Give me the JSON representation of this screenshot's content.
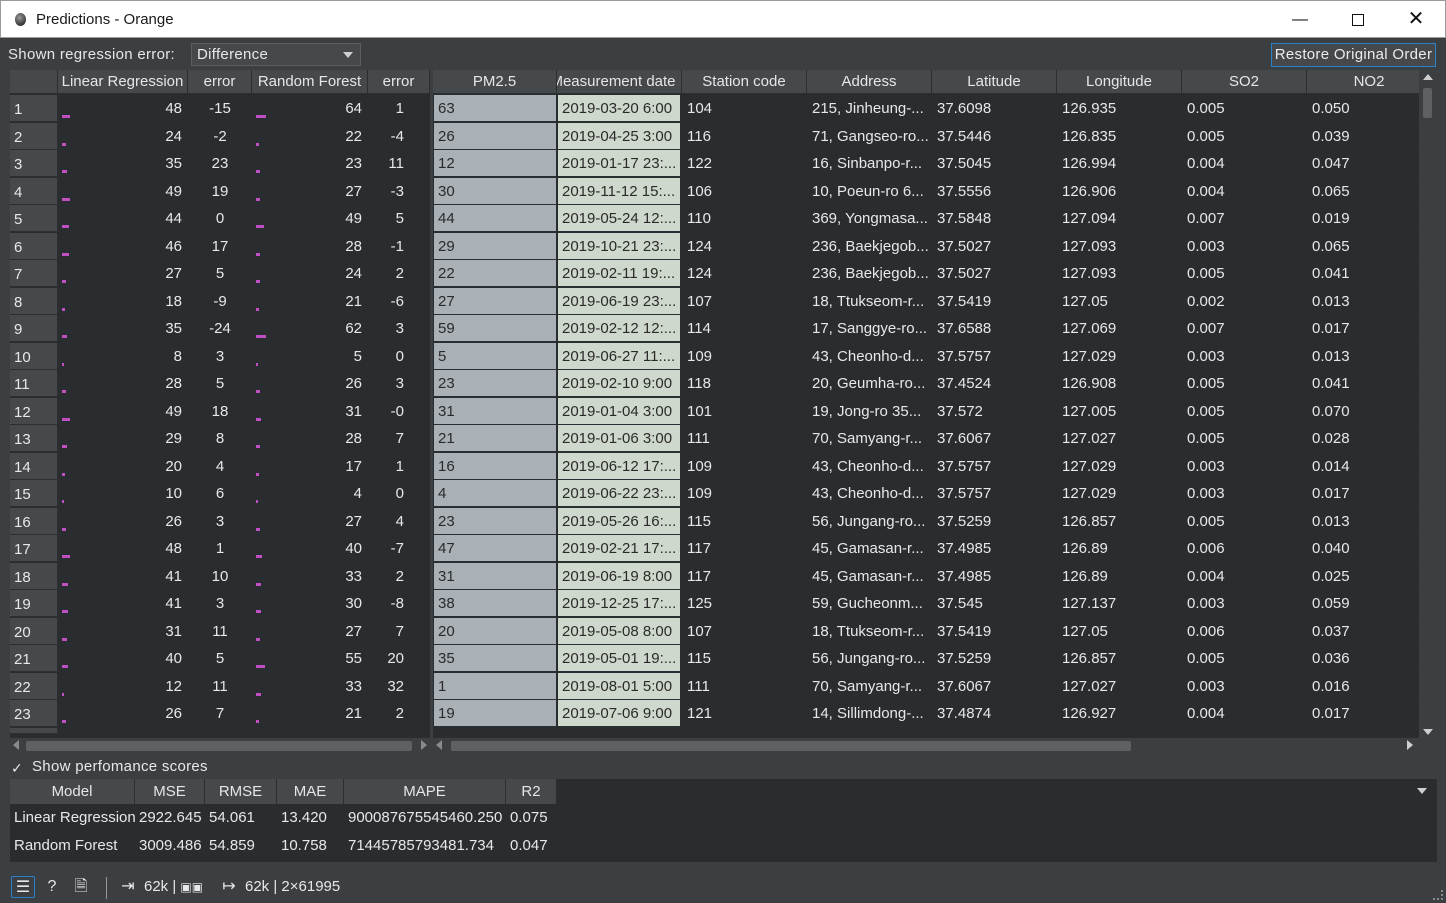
{
  "window": {
    "title": "Predictions - Orange"
  },
  "toolbar": {
    "error_label": "Shown regression error:",
    "error_mode": "Difference",
    "restore_button": "Restore Original Order"
  },
  "predictions": {
    "headers": [
      "Linear Regression",
      "error",
      "Random Forest",
      "error"
    ],
    "rows": [
      [
        "1",
        "48",
        "-15",
        "64",
        "1"
      ],
      [
        "2",
        "24",
        "-2",
        "22",
        "-4"
      ],
      [
        "3",
        "35",
        "23",
        "23",
        "11"
      ],
      [
        "4",
        "49",
        "19",
        "27",
        "-3"
      ],
      [
        "5",
        "44",
        "0",
        "49",
        "5"
      ],
      [
        "6",
        "46",
        "17",
        "28",
        "-1"
      ],
      [
        "7",
        "27",
        "5",
        "24",
        "2"
      ],
      [
        "8",
        "18",
        "-9",
        "21",
        "-6"
      ],
      [
        "9",
        "35",
        "-24",
        "62",
        "3"
      ],
      [
        "10",
        "8",
        "3",
        "5",
        "0"
      ],
      [
        "11",
        "28",
        "5",
        "26",
        "3"
      ],
      [
        "12",
        "49",
        "18",
        "31",
        "-0"
      ],
      [
        "13",
        "29",
        "8",
        "28",
        "7"
      ],
      [
        "14",
        "20",
        "4",
        "17",
        "1"
      ],
      [
        "15",
        "10",
        "6",
        "4",
        "0"
      ],
      [
        "16",
        "26",
        "3",
        "27",
        "4"
      ],
      [
        "17",
        "48",
        "1",
        "40",
        "-7"
      ],
      [
        "18",
        "41",
        "10",
        "33",
        "2"
      ],
      [
        "19",
        "41",
        "3",
        "30",
        "-8"
      ],
      [
        "20",
        "31",
        "11",
        "27",
        "7"
      ],
      [
        "21",
        "40",
        "5",
        "55",
        "20"
      ],
      [
        "22",
        "12",
        "11",
        "33",
        "32"
      ],
      [
        "23",
        "26",
        "7",
        "21",
        "2"
      ]
    ]
  },
  "data_table": {
    "headers": [
      "PM2.5",
      "Measurement date",
      "Station code",
      "Address",
      "Latitude",
      "Longitude",
      "SO2",
      "NO2"
    ],
    "rows": [
      [
        "63",
        "2019-03-20 6:00",
        "104",
        "215, Jinheung-...",
        "37.6098",
        "126.935",
        "0.005",
        "0.050"
      ],
      [
        "26",
        "2019-04-25 3:00",
        "116",
        "71, Gangseo-ro...",
        "37.5446",
        "126.835",
        "0.005",
        "0.039"
      ],
      [
        "12",
        "2019-01-17 23:...",
        "122",
        "16, Sinbanpo-r...",
        "37.5045",
        "126.994",
        "0.004",
        "0.047"
      ],
      [
        "30",
        "2019-11-12 15:...",
        "106",
        "10, Poeun-ro 6...",
        "37.5556",
        "126.906",
        "0.004",
        "0.065"
      ],
      [
        "44",
        "2019-05-24 12:...",
        "110",
        "369, Yongmasa...",
        "37.5848",
        "127.094",
        "0.007",
        "0.019"
      ],
      [
        "29",
        "2019-10-21 23:...",
        "124",
        "236, Baekjegob...",
        "37.5027",
        "127.093",
        "0.003",
        "0.065"
      ],
      [
        "22",
        "2019-02-11 19:...",
        "124",
        "236, Baekjegob...",
        "37.5027",
        "127.093",
        "0.005",
        "0.041"
      ],
      [
        "27",
        "2019-06-19 23:...",
        "107",
        "18, Ttukseom-r...",
        "37.5419",
        "127.05",
        "0.002",
        "0.013"
      ],
      [
        "59",
        "2019-02-12 12:...",
        "114",
        "17, Sanggye-ro...",
        "37.6588",
        "127.069",
        "0.007",
        "0.017"
      ],
      [
        "5",
        "2019-06-27 11:...",
        "109",
        "43, Cheonho-d...",
        "37.5757",
        "127.029",
        "0.003",
        "0.013"
      ],
      [
        "23",
        "2019-02-10 9:00",
        "118",
        "20, Geumha-ro...",
        "37.4524",
        "126.908",
        "0.005",
        "0.041"
      ],
      [
        "31",
        "2019-01-04 3:00",
        "101",
        "19, Jong-ro 35...",
        "37.572",
        "127.005",
        "0.005",
        "0.070"
      ],
      [
        "21",
        "2019-01-06 3:00",
        "111",
        "70, Samyang-r...",
        "37.6067",
        "127.027",
        "0.005",
        "0.028"
      ],
      [
        "16",
        "2019-06-12 17:...",
        "109",
        "43, Cheonho-d...",
        "37.5757",
        "127.029",
        "0.003",
        "0.014"
      ],
      [
        "4",
        "2019-06-22 23:...",
        "109",
        "43, Cheonho-d...",
        "37.5757",
        "127.029",
        "0.003",
        "0.017"
      ],
      [
        "23",
        "2019-05-26 16:...",
        "115",
        "56, Jungang-ro...",
        "37.5259",
        "126.857",
        "0.005",
        "0.013"
      ],
      [
        "47",
        "2019-02-21 17:...",
        "117",
        "45, Gamasan-r...",
        "37.4985",
        "126.89",
        "0.006",
        "0.040"
      ],
      [
        "31",
        "2019-06-19 8:00",
        "117",
        "45, Gamasan-r...",
        "37.4985",
        "126.89",
        "0.004",
        "0.025"
      ],
      [
        "38",
        "2019-12-25 17:...",
        "125",
        "59, Gucheonm...",
        "37.545",
        "127.137",
        "0.003",
        "0.059"
      ],
      [
        "20",
        "2019-05-08 8:00",
        "107",
        "18, Ttukseom-r...",
        "37.5419",
        "127.05",
        "0.006",
        "0.037"
      ],
      [
        "35",
        "2019-05-01 19:...",
        "115",
        "56, Jungang-ro...",
        "37.5259",
        "126.857",
        "0.005",
        "0.036"
      ],
      [
        "1",
        "2019-08-01 5:00",
        "111",
        "70, Samyang-r...",
        "37.6067",
        "127.027",
        "0.003",
        "0.016"
      ],
      [
        "19",
        "2019-07-06 9:00",
        "121",
        "14, Sillimdong-...",
        "37.4874",
        "126.927",
        "0.004",
        "0.017"
      ]
    ]
  },
  "scores": {
    "show_label": "Show perfomance scores",
    "headers": [
      "Model",
      "MSE",
      "RMSE",
      "MAE",
      "MAPE",
      "R2"
    ],
    "rows": [
      [
        "Linear Regression",
        "2922.645",
        "54.061",
        "13.420",
        "900087675545460.250",
        "0.075"
      ],
      [
        "Random Forest",
        "3009.486",
        "54.859",
        "10.758",
        "71445785793481.734",
        "0.047"
      ]
    ]
  },
  "status": {
    "input_summary": "62k | ",
    "output_summary": "62k | 2×61995"
  },
  "colors": {
    "accent": "#2b80c9",
    "bar": "#c04fc3",
    "pm_cell": "#a9b0b6",
    "date_cell": "#cfd8cc"
  }
}
